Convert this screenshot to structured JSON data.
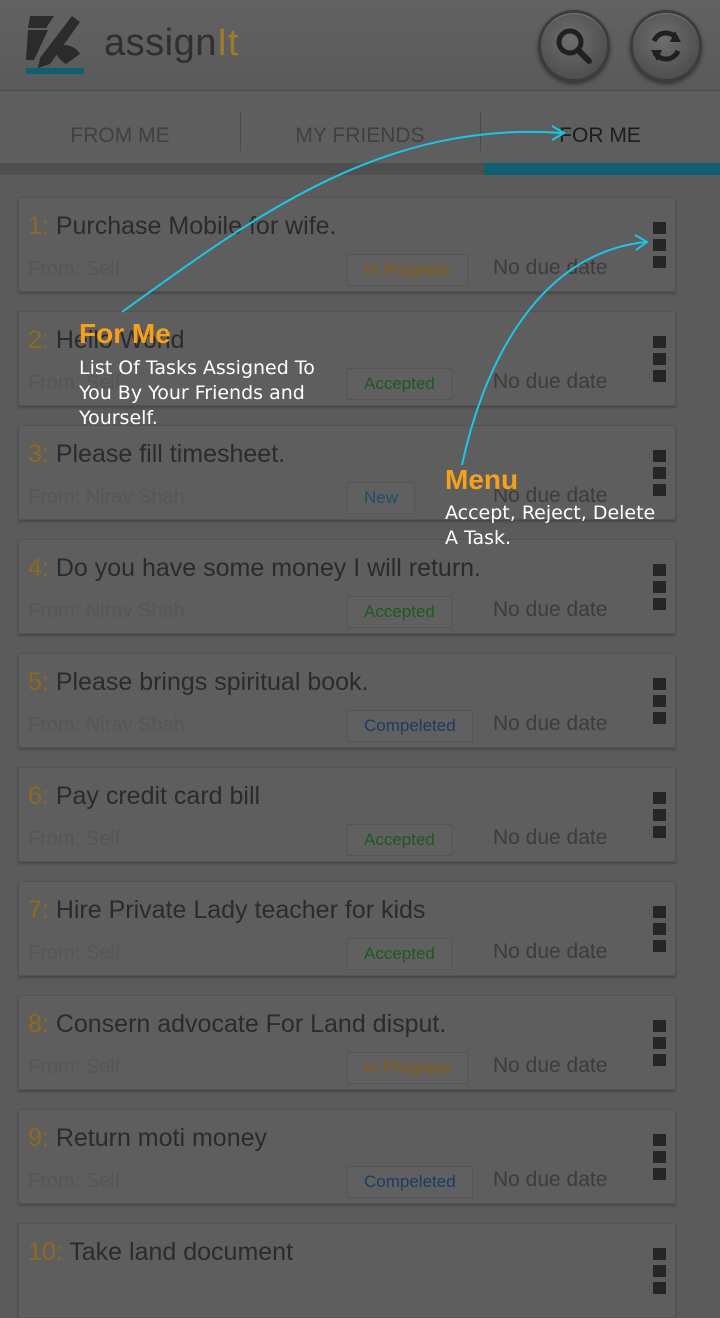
{
  "app": {
    "name_main": "assign",
    "name_accent": "It"
  },
  "header": {
    "search_icon": "search-icon",
    "refresh_icon": "refresh-icon"
  },
  "tabs": [
    {
      "label": "FROM ME",
      "active": false
    },
    {
      "label": "MY FRIENDS",
      "active": false
    },
    {
      "label": "FOR ME",
      "active": true
    }
  ],
  "colors": {
    "accent": "#0f5e72",
    "number": "#8f6a1e",
    "coach_title": "#f5a11b",
    "arrow": "#1cc6e8",
    "status_in_progress": "#8a5d14",
    "status_accepted": "#1d5a1d",
    "status_new": "#1c4e68",
    "status_compeleted": "#1b3b63"
  },
  "tasks": [
    {
      "num": "1:",
      "title": "Purchase Mobile for wife.",
      "from": "From: Self",
      "status": "In Progress",
      "status_type": "in_progress",
      "due": "No due date"
    },
    {
      "num": "2:",
      "title": "Hello World",
      "from": "From: Self",
      "status": "Accepted",
      "status_type": "accepted",
      "due": "No due date"
    },
    {
      "num": "3:",
      "title": "Please fill timesheet.",
      "from": "From: Nirav Shah",
      "status": "New",
      "status_type": "new",
      "due": "No due date"
    },
    {
      "num": "4:",
      "title": "Do you have some money I will return.",
      "from": "From: Nirav Shah",
      "status": "Accepted",
      "status_type": "accepted",
      "due": "No due date"
    },
    {
      "num": "5:",
      "title": "Please brings spiritual book.",
      "from": "From: Nirav Shah",
      "status": "Compeleted",
      "status_type": "compeleted",
      "due": "No due date"
    },
    {
      "num": "6:",
      "title": "Pay credit card bill",
      "from": "From: Self",
      "status": "Accepted",
      "status_type": "accepted",
      "due": "No due date"
    },
    {
      "num": "7:",
      "title": "Hire Private Lady teacher for kids",
      "from": "From: Self",
      "status": "Accepted",
      "status_type": "accepted",
      "due": "No due date"
    },
    {
      "num": "8:",
      "title": "Consern advocate For Land disput.",
      "from": "From: Self",
      "status": "In Progress",
      "status_type": "in_progress",
      "due": "No due date"
    },
    {
      "num": "9:",
      "title": "Return moti money",
      "from": "From: Self",
      "status": "Compeleted",
      "status_type": "compeleted",
      "due": "No due date"
    },
    {
      "num": "10:",
      "title": "Take land document",
      "from": "",
      "status": "",
      "status_type": "",
      "due": ""
    }
  ],
  "coach": {
    "for_me": {
      "title": "For Me",
      "desc": "List Of Tasks Assigned To You By Your Friends and Yourself."
    },
    "menu": {
      "title": "Menu",
      "desc": "Accept, Reject, Delete A Task."
    }
  }
}
